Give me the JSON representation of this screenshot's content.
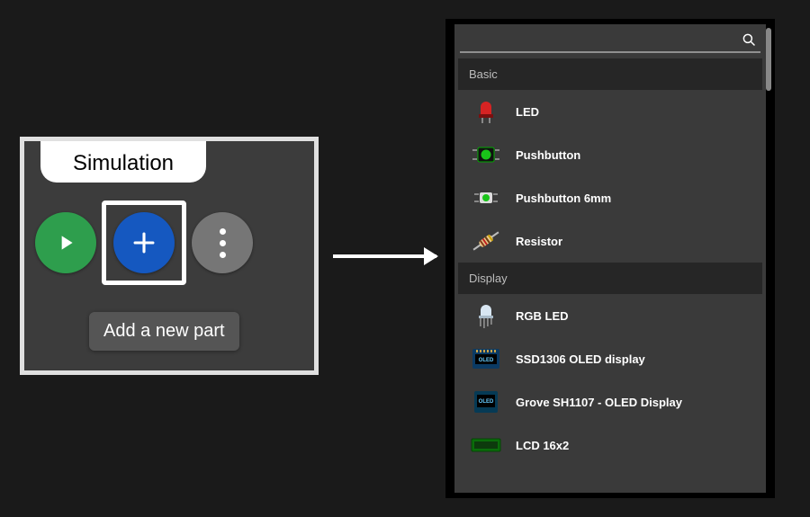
{
  "toolbar": {
    "tab_label": "Simulation",
    "tooltip": "Add a new part"
  },
  "search": {
    "placeholder": ""
  },
  "sections": {
    "basic": {
      "title": "Basic"
    },
    "display": {
      "title": "Display"
    }
  },
  "parts": {
    "basic": [
      {
        "label": "LED"
      },
      {
        "label": "Pushbutton"
      },
      {
        "label": "Pushbutton 6mm"
      },
      {
        "label": "Resistor"
      }
    ],
    "display": [
      {
        "label": "RGB LED"
      },
      {
        "label": "SSD1306 OLED display"
      },
      {
        "label": "Grove SH1107 - OLED Display"
      },
      {
        "label": "LCD 16x2"
      }
    ]
  }
}
